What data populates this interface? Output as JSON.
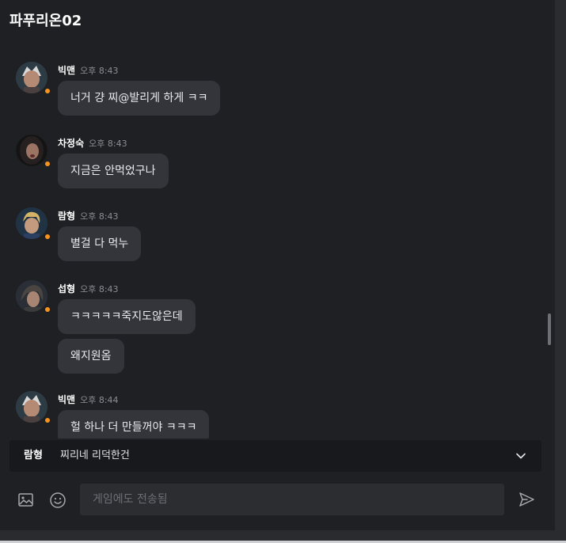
{
  "header": {
    "title": "파푸리온02"
  },
  "messages": [
    {
      "name": "빅맨",
      "time": "오후 8:43",
      "bubbles": [
        "너거 걍 찌@발리게 하게 ㅋㅋ"
      ]
    },
    {
      "name": "차정숙",
      "time": "오후 8:43",
      "bubbles": [
        "지금은 안먹었구나"
      ]
    },
    {
      "name": "람형",
      "time": "오후 8:43",
      "bubbles": [
        "별걸 다 먹누"
      ]
    },
    {
      "name": "섭형",
      "time": "오후 8:43",
      "bubbles": [
        "ㅋㅋㅋㅋㅋ죽지도않은데",
        "왜지원옴"
      ]
    },
    {
      "name": "빅맨",
      "time": "오후 8:44",
      "bubbles": [
        "헐 하나 더 만들꺼야 ㅋㅋㅋ"
      ]
    }
  ],
  "mention_bar": {
    "name": "람형",
    "text": "찌리네 리덕한건"
  },
  "composer": {
    "placeholder": "게임에도 전송됨"
  },
  "icons": {
    "image": "image-icon",
    "emoji": "emoji-icon",
    "send": "send-icon",
    "expand": "chevron-down-icon"
  },
  "colors": {
    "status_dot": "#f7941d",
    "bubble": "#33353b",
    "background": "#1f2023"
  }
}
